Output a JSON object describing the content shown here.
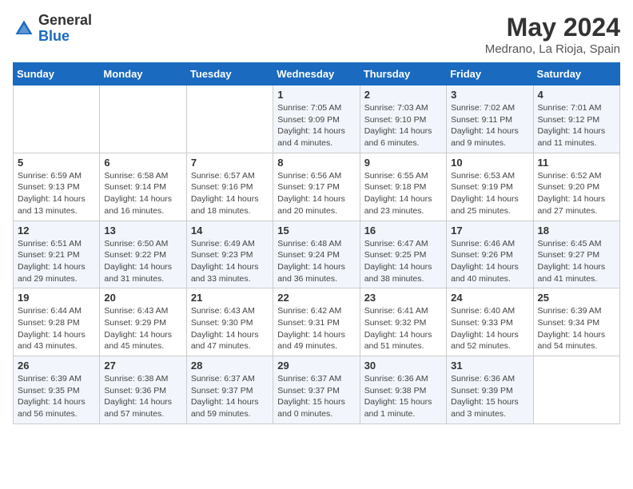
{
  "header": {
    "logo_general": "General",
    "logo_blue": "Blue",
    "title": "May 2024",
    "location": "Medrano, La Rioja, Spain"
  },
  "weekdays": [
    "Sunday",
    "Monday",
    "Tuesday",
    "Wednesday",
    "Thursday",
    "Friday",
    "Saturday"
  ],
  "weeks": [
    [
      {
        "day": "",
        "info": ""
      },
      {
        "day": "",
        "info": ""
      },
      {
        "day": "",
        "info": ""
      },
      {
        "day": "1",
        "info": "Sunrise: 7:05 AM\nSunset: 9:09 PM\nDaylight: 14 hours\nand 4 minutes."
      },
      {
        "day": "2",
        "info": "Sunrise: 7:03 AM\nSunset: 9:10 PM\nDaylight: 14 hours\nand 6 minutes."
      },
      {
        "day": "3",
        "info": "Sunrise: 7:02 AM\nSunset: 9:11 PM\nDaylight: 14 hours\nand 9 minutes."
      },
      {
        "day": "4",
        "info": "Sunrise: 7:01 AM\nSunset: 9:12 PM\nDaylight: 14 hours\nand 11 minutes."
      }
    ],
    [
      {
        "day": "5",
        "info": "Sunrise: 6:59 AM\nSunset: 9:13 PM\nDaylight: 14 hours\nand 13 minutes."
      },
      {
        "day": "6",
        "info": "Sunrise: 6:58 AM\nSunset: 9:14 PM\nDaylight: 14 hours\nand 16 minutes."
      },
      {
        "day": "7",
        "info": "Sunrise: 6:57 AM\nSunset: 9:16 PM\nDaylight: 14 hours\nand 18 minutes."
      },
      {
        "day": "8",
        "info": "Sunrise: 6:56 AM\nSunset: 9:17 PM\nDaylight: 14 hours\nand 20 minutes."
      },
      {
        "day": "9",
        "info": "Sunrise: 6:55 AM\nSunset: 9:18 PM\nDaylight: 14 hours\nand 23 minutes."
      },
      {
        "day": "10",
        "info": "Sunrise: 6:53 AM\nSunset: 9:19 PM\nDaylight: 14 hours\nand 25 minutes."
      },
      {
        "day": "11",
        "info": "Sunrise: 6:52 AM\nSunset: 9:20 PM\nDaylight: 14 hours\nand 27 minutes."
      }
    ],
    [
      {
        "day": "12",
        "info": "Sunrise: 6:51 AM\nSunset: 9:21 PM\nDaylight: 14 hours\nand 29 minutes."
      },
      {
        "day": "13",
        "info": "Sunrise: 6:50 AM\nSunset: 9:22 PM\nDaylight: 14 hours\nand 31 minutes."
      },
      {
        "day": "14",
        "info": "Sunrise: 6:49 AM\nSunset: 9:23 PM\nDaylight: 14 hours\nand 33 minutes."
      },
      {
        "day": "15",
        "info": "Sunrise: 6:48 AM\nSunset: 9:24 PM\nDaylight: 14 hours\nand 36 minutes."
      },
      {
        "day": "16",
        "info": "Sunrise: 6:47 AM\nSunset: 9:25 PM\nDaylight: 14 hours\nand 38 minutes."
      },
      {
        "day": "17",
        "info": "Sunrise: 6:46 AM\nSunset: 9:26 PM\nDaylight: 14 hours\nand 40 minutes."
      },
      {
        "day": "18",
        "info": "Sunrise: 6:45 AM\nSunset: 9:27 PM\nDaylight: 14 hours\nand 41 minutes."
      }
    ],
    [
      {
        "day": "19",
        "info": "Sunrise: 6:44 AM\nSunset: 9:28 PM\nDaylight: 14 hours\nand 43 minutes."
      },
      {
        "day": "20",
        "info": "Sunrise: 6:43 AM\nSunset: 9:29 PM\nDaylight: 14 hours\nand 45 minutes."
      },
      {
        "day": "21",
        "info": "Sunrise: 6:43 AM\nSunset: 9:30 PM\nDaylight: 14 hours\nand 47 minutes."
      },
      {
        "day": "22",
        "info": "Sunrise: 6:42 AM\nSunset: 9:31 PM\nDaylight: 14 hours\nand 49 minutes."
      },
      {
        "day": "23",
        "info": "Sunrise: 6:41 AM\nSunset: 9:32 PM\nDaylight: 14 hours\nand 51 minutes."
      },
      {
        "day": "24",
        "info": "Sunrise: 6:40 AM\nSunset: 9:33 PM\nDaylight: 14 hours\nand 52 minutes."
      },
      {
        "day": "25",
        "info": "Sunrise: 6:39 AM\nSunset: 9:34 PM\nDaylight: 14 hours\nand 54 minutes."
      }
    ],
    [
      {
        "day": "26",
        "info": "Sunrise: 6:39 AM\nSunset: 9:35 PM\nDaylight: 14 hours\nand 56 minutes."
      },
      {
        "day": "27",
        "info": "Sunrise: 6:38 AM\nSunset: 9:36 PM\nDaylight: 14 hours\nand 57 minutes."
      },
      {
        "day": "28",
        "info": "Sunrise: 6:37 AM\nSunset: 9:37 PM\nDaylight: 14 hours\nand 59 minutes."
      },
      {
        "day": "29",
        "info": "Sunrise: 6:37 AM\nSunset: 9:37 PM\nDaylight: 15 hours\nand 0 minutes."
      },
      {
        "day": "30",
        "info": "Sunrise: 6:36 AM\nSunset: 9:38 PM\nDaylight: 15 hours\nand 1 minute."
      },
      {
        "day": "31",
        "info": "Sunrise: 6:36 AM\nSunset: 9:39 PM\nDaylight: 15 hours\nand 3 minutes."
      },
      {
        "day": "",
        "info": ""
      }
    ]
  ]
}
